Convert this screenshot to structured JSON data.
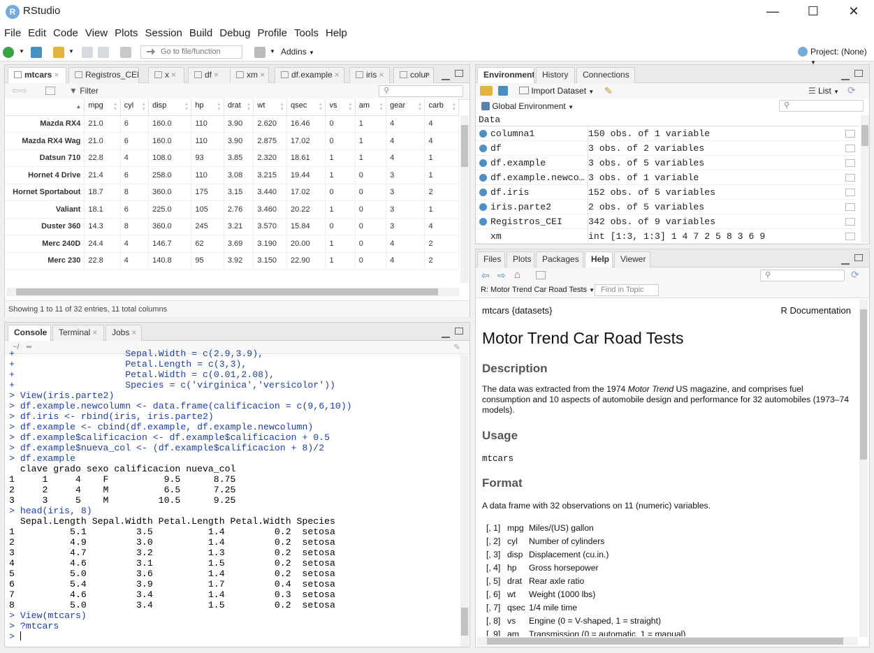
{
  "app": {
    "title": "RStudio",
    "logo_letter": "R"
  },
  "menu": [
    "File",
    "Edit",
    "Code",
    "View",
    "Plots",
    "Session",
    "Build",
    "Debug",
    "Profile",
    "Tools",
    "Help"
  ],
  "toolbar": {
    "goto_placeholder": "Go to file/function",
    "addins": "Addins",
    "project": "Project: (None)"
  },
  "source": {
    "tabs": [
      "mtcars",
      "Registros_CEI",
      "x",
      "df",
      "xm",
      "df.example",
      "iris",
      "colur"
    ],
    "filter": "Filter",
    "columns": [
      "mpg",
      "cyl",
      "disp",
      "hp",
      "drat",
      "wt",
      "qsec",
      "vs",
      "am",
      "gear",
      "carb"
    ],
    "rows": [
      [
        "Mazda RX4",
        "21.0",
        "6",
        "160.0",
        "110",
        "3.90",
        "2.620",
        "16.46",
        "0",
        "1",
        "4",
        "4"
      ],
      [
        "Mazda RX4 Wag",
        "21.0",
        "6",
        "160.0",
        "110",
        "3.90",
        "2.875",
        "17.02",
        "0",
        "1",
        "4",
        "4"
      ],
      [
        "Datsun 710",
        "22.8",
        "4",
        "108.0",
        "93",
        "3.85",
        "2.320",
        "18.61",
        "1",
        "1",
        "4",
        "1"
      ],
      [
        "Hornet 4 Drive",
        "21.4",
        "6",
        "258.0",
        "110",
        "3.08",
        "3.215",
        "19.44",
        "1",
        "0",
        "3",
        "1"
      ],
      [
        "Hornet Sportabout",
        "18.7",
        "8",
        "360.0",
        "175",
        "3.15",
        "3.440",
        "17.02",
        "0",
        "0",
        "3",
        "2"
      ],
      [
        "Valiant",
        "18.1",
        "6",
        "225.0",
        "105",
        "2.76",
        "3.460",
        "20.22",
        "1",
        "0",
        "3",
        "1"
      ],
      [
        "Duster 360",
        "14.3",
        "8",
        "360.0",
        "245",
        "3.21",
        "3.570",
        "15.84",
        "0",
        "0",
        "3",
        "4"
      ],
      [
        "Merc 240D",
        "24.4",
        "4",
        "146.7",
        "62",
        "3.69",
        "3.190",
        "20.00",
        "1",
        "0",
        "4",
        "2"
      ],
      [
        "Merc 230",
        "22.8",
        "4",
        "140.8",
        "95",
        "3.92",
        "3.150",
        "22.90",
        "1",
        "0",
        "4",
        "2"
      ]
    ],
    "status": "Showing 1 to 11 of 32 entries, 11 total columns"
  },
  "console": {
    "tabs": [
      "Console",
      "Terminal",
      "Jobs"
    ],
    "path": "~/",
    "lines": [
      [
        "+",
        "                   Sepal.Width = c(2.9,3.9),"
      ],
      [
        "+",
        "                   Petal.Length = c(3,3),"
      ],
      [
        "+",
        "                   Petal.Width = c(0.01,2.08),"
      ],
      [
        "+",
        "                   Species = c('virginica','versicolor'))"
      ],
      [
        ">",
        "View(iris.parte2)"
      ],
      [
        ">",
        "df.example.newcolumn <- data.frame(calificacion = c(9,6,10))"
      ],
      [
        ">",
        "df.iris <- rbind(iris, iris.parte2)"
      ],
      [
        ">",
        "df.example <- cbind(df.example, df.example.newcolumn)"
      ],
      [
        ">",
        "df.example$calificacion <- df.example$calificacion + 0.5"
      ],
      [
        ">",
        "df.example$nueva_col <- (df.example$calificacion + 8)/2"
      ],
      [
        ">",
        "df.example"
      ],
      [
        "",
        "  clave grado sexo calificacion nueva_col"
      ],
      [
        "",
        "1     1     4    F          9.5      8.75"
      ],
      [
        "",
        "2     2     4    M          6.5      7.25"
      ],
      [
        "",
        "3     3     5    M         10.5      9.25"
      ],
      [
        ">",
        "head(iris, 8)"
      ],
      [
        "",
        "  Sepal.Length Sepal.Width Petal.Length Petal.Width Species"
      ],
      [
        "",
        "1          5.1         3.5          1.4         0.2  setosa"
      ],
      [
        "",
        "2          4.9         3.0          1.4         0.2  setosa"
      ],
      [
        "",
        "3          4.7         3.2          1.3         0.2  setosa"
      ],
      [
        "",
        "4          4.6         3.1          1.5         0.2  setosa"
      ],
      [
        "",
        "5          5.0         3.6          1.4         0.2  setosa"
      ],
      [
        "",
        "6          5.4         3.9          1.7         0.4  setosa"
      ],
      [
        "",
        "7          4.6         3.4          1.4         0.3  setosa"
      ],
      [
        "",
        "8          5.0         3.4          1.5         0.2  setosa"
      ],
      [
        ">",
        "View(mtcars)"
      ],
      [
        ">",
        "?mtcars"
      ],
      [
        ">",
        ""
      ]
    ]
  },
  "environment": {
    "tabs": [
      "Environment",
      "History",
      "Connections"
    ],
    "import": "Import Dataset",
    "list": "List",
    "scope": "Global Environment",
    "section": "Data",
    "items": [
      [
        "columna1",
        "150 obs. of 1 variable"
      ],
      [
        "df",
        "3 obs. of 2 variables"
      ],
      [
        "df.example",
        "3 obs. of 5 variables"
      ],
      [
        "df.example.newco…",
        "3 obs. of 1 variable"
      ],
      [
        "df.iris",
        "152 obs. of 5 variables"
      ],
      [
        "iris.parte2",
        "2 obs. of 5 variables"
      ],
      [
        "Registros_CEI",
        "342 obs. of 9 variables"
      ],
      [
        "xm",
        "int [1:3, 1:3] 1 4 7 2 5 8 3 6 9"
      ]
    ]
  },
  "help": {
    "tabs": [
      "Files",
      "Plots",
      "Packages",
      "Help",
      "Viewer"
    ],
    "topic": "R: Motor Trend Car Road Tests",
    "find_placeholder": "Find in Topic",
    "pkg": "mtcars {datasets}",
    "rdoc": "R Documentation",
    "title": "Motor Trend Car Road Tests",
    "h_description": "Description",
    "desc_pre": "The data was extracted from the 1974 ",
    "desc_em": "Motor Trend",
    "desc_post": " US magazine, and comprises fuel consumption and 10 aspects of automobile design and performance for 32 automobiles (1973–74 models).",
    "h_usage": "Usage",
    "usage": "mtcars",
    "h_format": "Format",
    "format": "A data frame with 32 observations on 11 (numeric) variables.",
    "vars": [
      [
        "[, 1]",
        "mpg",
        "Miles/(US) gallon"
      ],
      [
        "[, 2]",
        "cyl",
        "Number of cylinders"
      ],
      [
        "[, 3]",
        "disp",
        "Displacement (cu.in.)"
      ],
      [
        "[, 4]",
        "hp",
        "Gross horsepower"
      ],
      [
        "[, 5]",
        "drat",
        "Rear axle ratio"
      ],
      [
        "[, 6]",
        "wt",
        "Weight (1000 lbs)"
      ],
      [
        "[, 7]",
        "qsec",
        "1/4 mile time"
      ],
      [
        "[, 8]",
        "vs",
        "Engine (0 = V-shaped, 1 = straight)"
      ],
      [
        "[, 9]",
        "am",
        "Transmission (0 = automatic, 1 = manual)"
      ]
    ]
  }
}
